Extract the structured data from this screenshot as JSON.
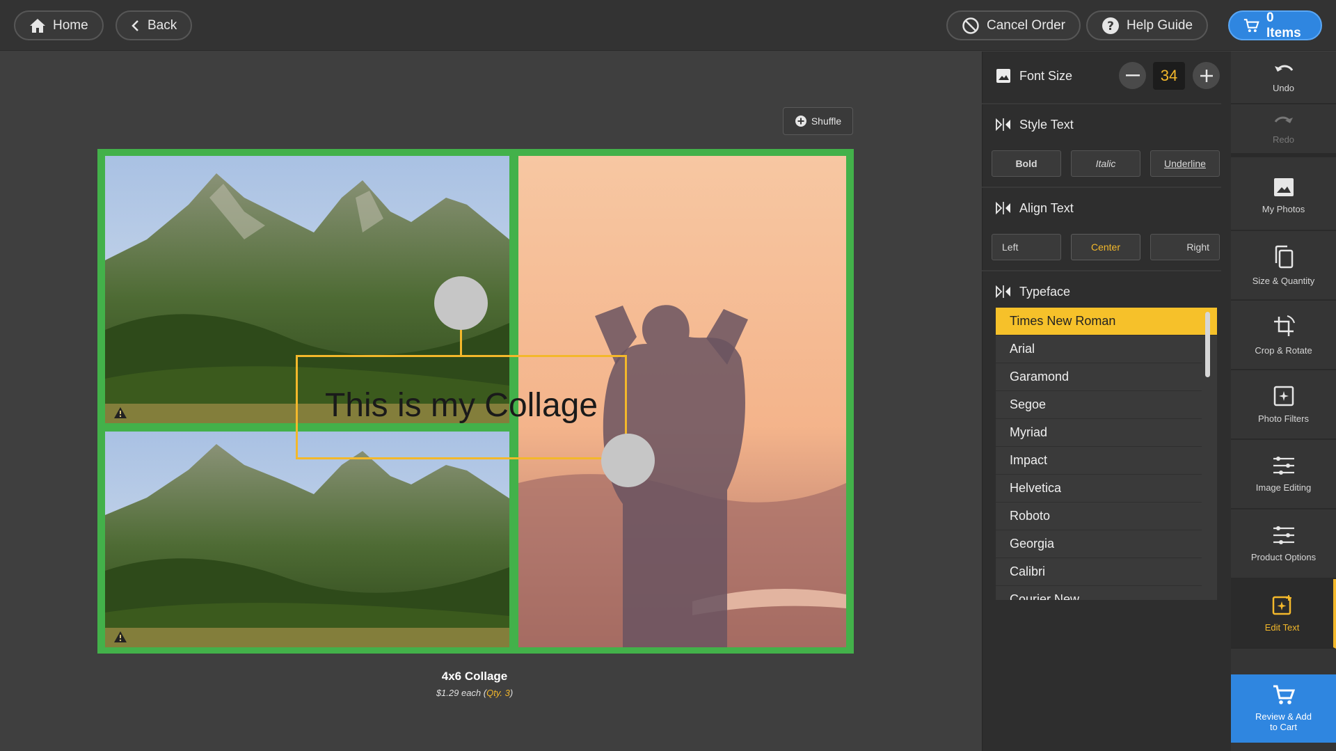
{
  "topbar": {
    "home_label": "Home",
    "back_label": "Back",
    "cancel_label": "Cancel Order",
    "help_label": "Help Guide",
    "cart_label": "0 Items"
  },
  "canvas": {
    "shuffle_label": "Shuffle",
    "collage_text": "This is my Collage",
    "product_title": "4x6 Collage",
    "price_prefix": "$1.29 each (",
    "price_qty": "Qty. 3",
    "price_suffix": ")"
  },
  "panel": {
    "font_size_label": "Font Size",
    "font_size_value": "34",
    "style_label": "Style Text",
    "style_buttons": [
      "Bold",
      "Italic",
      "Underline"
    ],
    "align_label": "Align Text",
    "align_buttons": [
      "Left",
      "Center",
      "Right"
    ],
    "align_active": "Center",
    "typeface_label": "Typeface",
    "typefaces": [
      "Times New Roman",
      "Arial",
      "Garamond",
      "Segoe",
      "Myriad",
      "Impact",
      "Helvetica",
      "Roboto",
      "Georgia",
      "Calibri",
      "Courier New"
    ],
    "typeface_selected": "Times New Roman"
  },
  "rail": {
    "items": [
      {
        "label": "Undo",
        "icon": "undo-icon"
      },
      {
        "label": "Redo",
        "icon": "redo-icon"
      },
      {
        "label": "My Photos",
        "icon": "photo-icon"
      },
      {
        "label": "Size & Quantity",
        "icon": "copies-icon"
      },
      {
        "label": "Crop & Rotate",
        "icon": "crop-rotate-icon"
      },
      {
        "label": "Photo Filters",
        "icon": "filter-icon"
      },
      {
        "label": "Image Editing",
        "icon": "sliders-icon"
      },
      {
        "label": "Product Options",
        "icon": "sliders-icon"
      },
      {
        "label": "Edit Text",
        "icon": "edit-text-icon"
      }
    ],
    "cart_line1": "Review & Add",
    "cart_line2": "to Cart"
  },
  "colors": {
    "accent": "#f3b82b",
    "cart_blue": "#2f86e0",
    "collage_border": "#43b14a"
  }
}
